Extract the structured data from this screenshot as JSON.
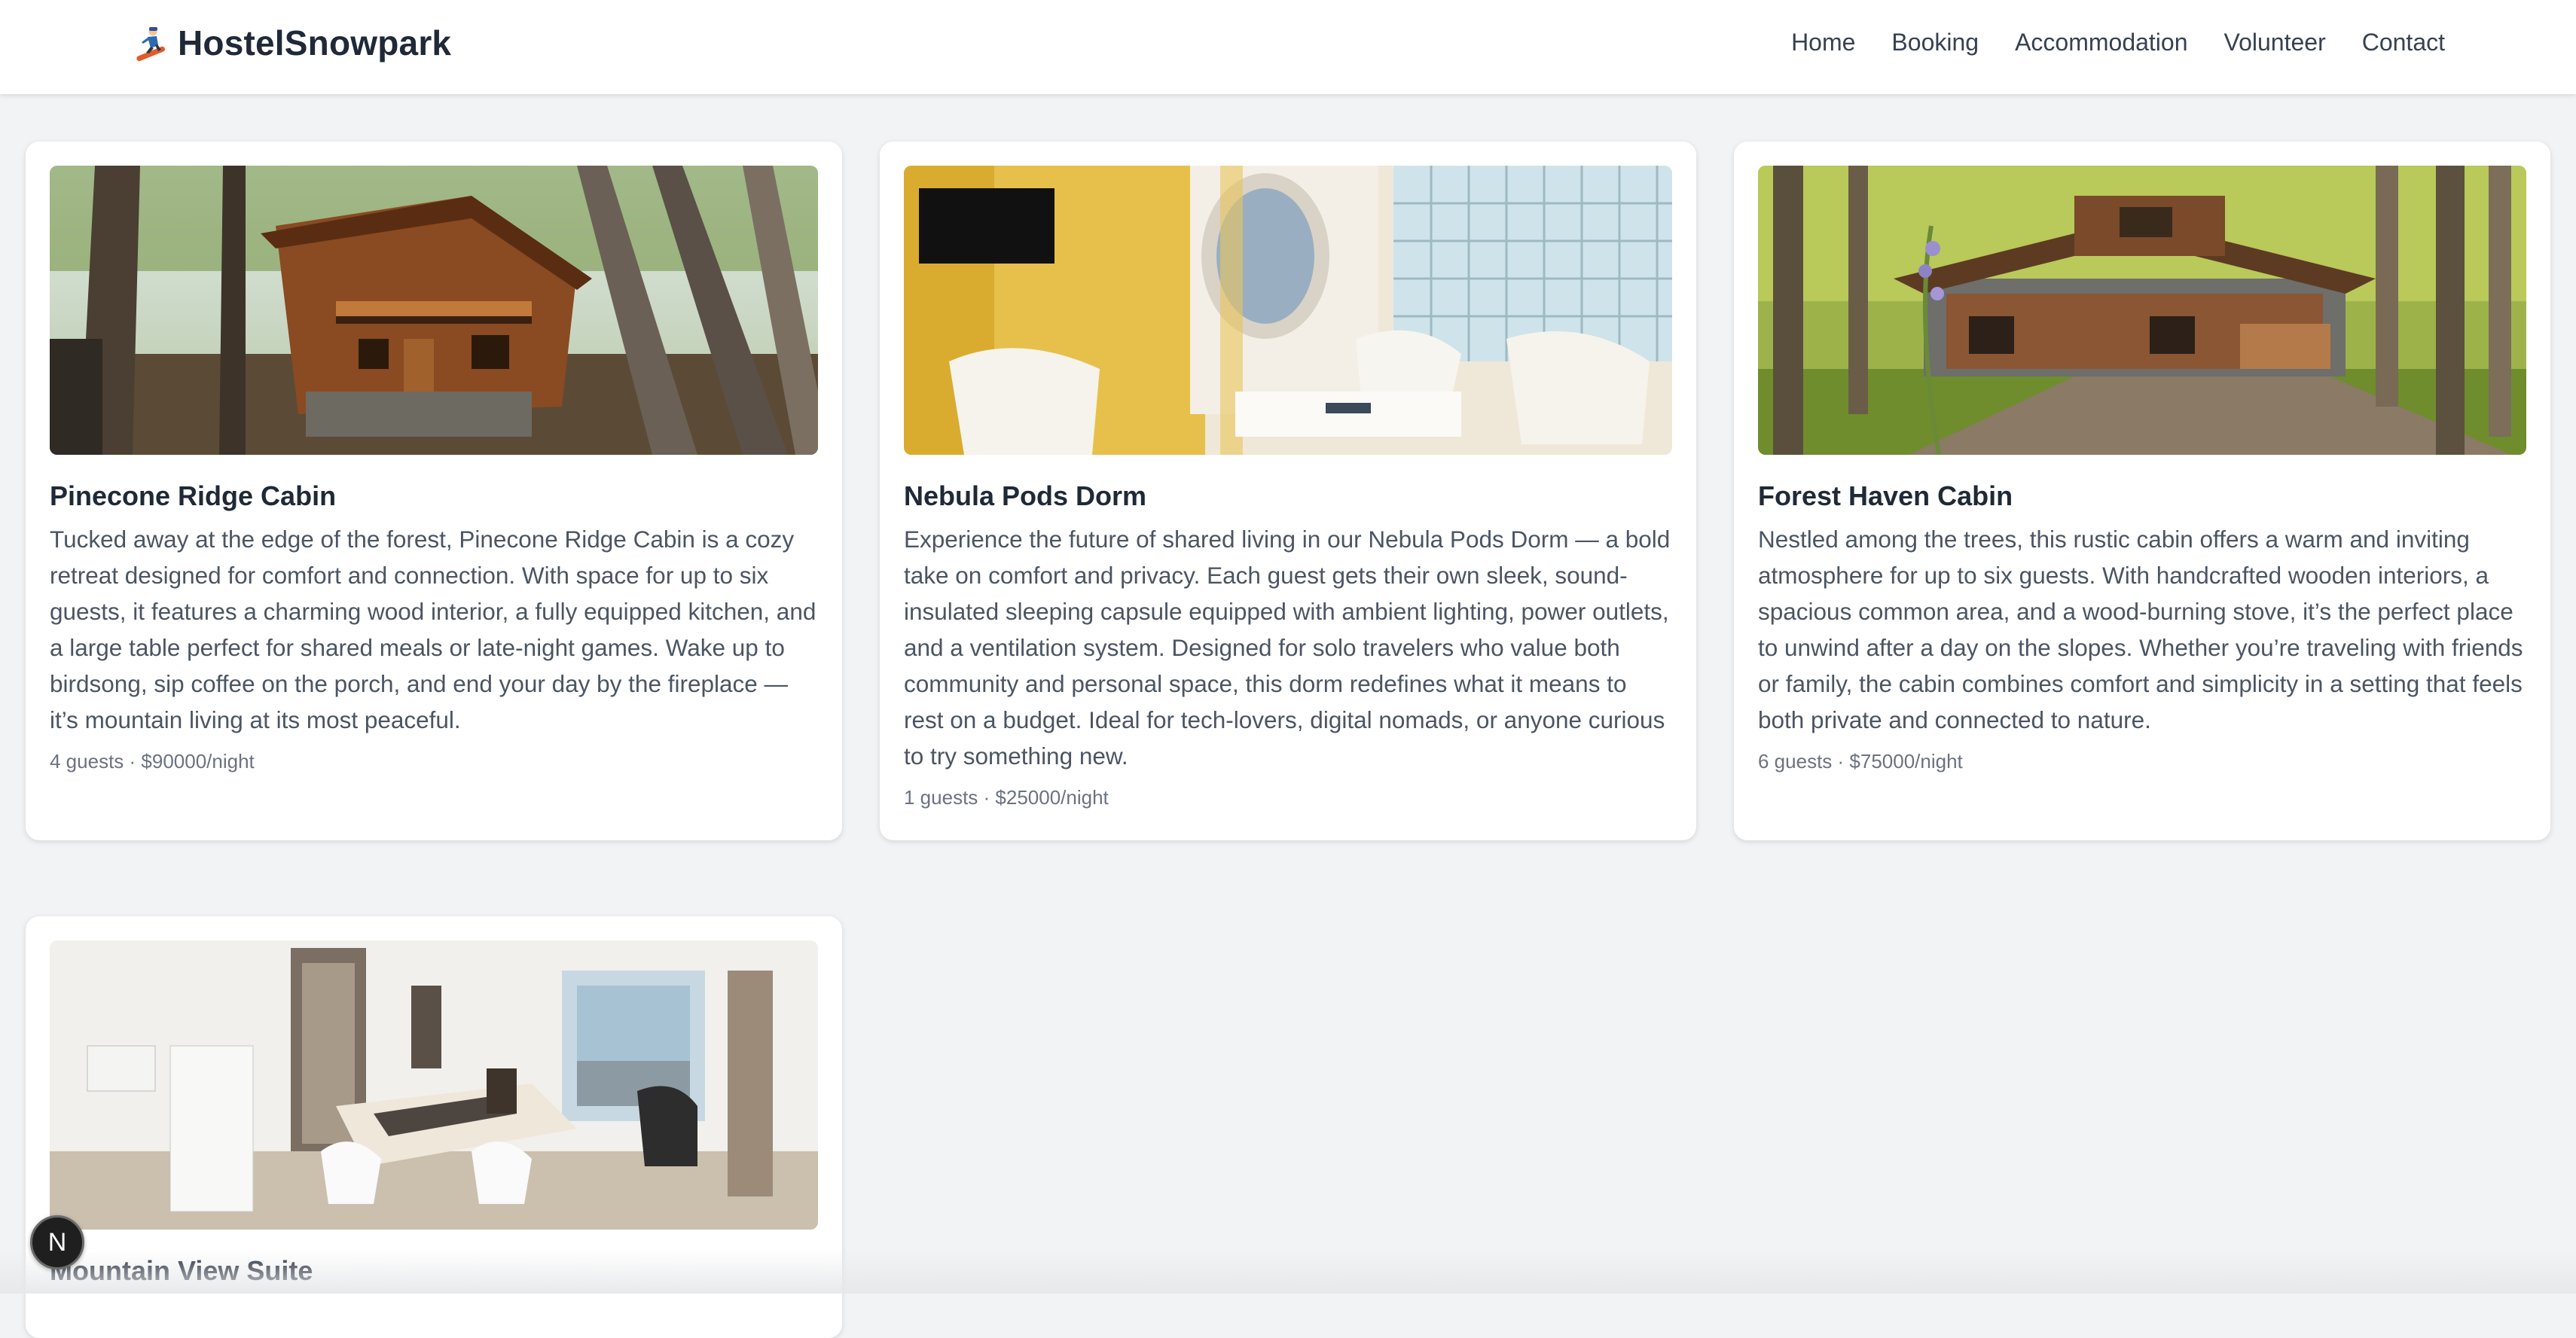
{
  "brand": {
    "name": "HostelSnowpark",
    "icon": "snowboarder-icon"
  },
  "nav": {
    "items": [
      {
        "label": "Home"
      },
      {
        "label": "Booking"
      },
      {
        "label": "Accommodation"
      },
      {
        "label": "Volunteer"
      },
      {
        "label": "Contact"
      }
    ]
  },
  "rooms": [
    {
      "title": "Pinecone Ridge Cabin",
      "description": "Tucked away at the edge of the forest, Pinecone Ridge Cabin is a cozy retreat designed for comfort and connection. With space for up to six guests, it features a charming wood interior, a fully equipped kitchen, and a large table perfect for shared meals or late-night games. Wake up to birdsong, sip coffee on the porch, and end your day by the fireplace — it’s mountain living at its most peaceful.",
      "meta": "4 guests · $90000/night",
      "image": "treehouse-cabin-photo"
    },
    {
      "title": "Nebula Pods Dorm",
      "description": "Experience the future of shared living in our Nebula Pods Dorm — a bold take on comfort and privacy. Each guest gets their own sleek, sound-insulated sleeping capsule equipped with ambient lighting, power outlets, and a ventilation system. Designed for solo travelers who value both community and personal space, this dorm redefines what it means to rest on a budget. Ideal for tech-lovers, digital nomads, or anyone curious to try something new.",
      "meta": "1 guests · $25000/night",
      "image": "pod-dorm-photo"
    },
    {
      "title": "Forest Haven Cabin",
      "description": "Nestled among the trees, this rustic cabin offers a warm and inviting atmosphere for up to six guests. With handcrafted wooden interiors, a spacious common area, and a wood-burning stove, it’s the perfect place to unwind after a day on the slopes. Whether you’re traveling with friends or family, the cabin combines comfort and simplicity in a setting that feels both private and connected to nature.",
      "meta": "6 guests · $75000/night",
      "image": "forest-cabin-photo"
    },
    {
      "title": "Mountain View Suite",
      "image": "suite-interior-photo"
    }
  ],
  "fab": {
    "label": "N"
  }
}
